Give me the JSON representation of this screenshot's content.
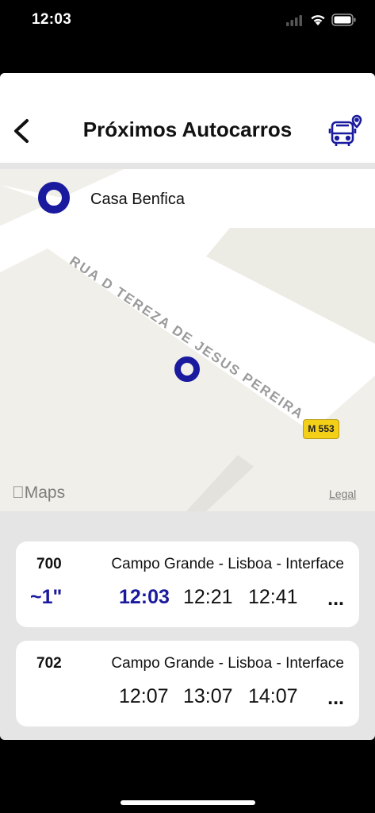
{
  "status_bar": {
    "time": "12:03"
  },
  "header": {
    "title": "Próximos Autocarros",
    "back_icon": "chevron-left-icon",
    "action_icon": "bus-location-icon"
  },
  "stop": {
    "name": "Casa Benfica"
  },
  "map": {
    "road_name": "RUA D TEREZA DE JESUS PEREIRA",
    "route_badge": "M 553",
    "brand": "Maps",
    "legal": "Legal"
  },
  "colors": {
    "accent": "#1a1a9e",
    "badge": "#f4cf18"
  },
  "departures": [
    {
      "line": "700",
      "destination": "Campo Grande - Lisboa - Interface",
      "eta": "~1\"",
      "times": [
        "12:03",
        "12:21",
        "12:41"
      ],
      "more": "..."
    },
    {
      "line": "702",
      "destination": "Campo Grande - Lisboa - Interface",
      "eta": "",
      "times": [
        "12:07",
        "13:07",
        "14:07"
      ],
      "more": "..."
    }
  ]
}
